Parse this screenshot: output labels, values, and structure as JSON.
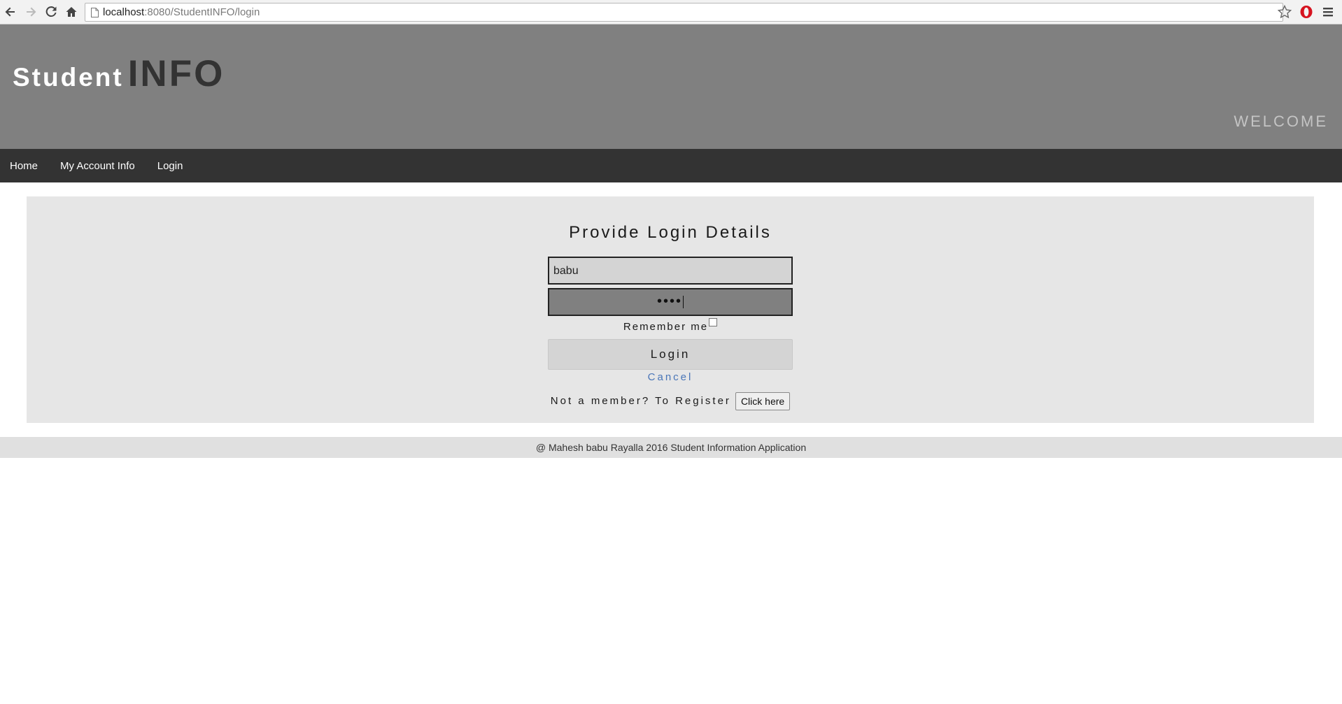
{
  "browser": {
    "url_host": "localhost",
    "url_rest": ":8080/StudentINFO/login",
    "back_icon": "back-arrow-icon",
    "forward_icon": "forward-arrow-icon",
    "reload_icon": "reload-icon",
    "home_icon": "home-icon",
    "bookmark_icon": "star-icon",
    "extension_icon": "opera-icon",
    "menu_icon": "hamburger-menu-icon"
  },
  "header": {
    "brand_student": "Student",
    "brand_info": "INFO",
    "welcome": "WELCOME",
    "background_color": "#808080"
  },
  "nav": {
    "items": [
      {
        "label": "Home"
      },
      {
        "label": "My Account Info"
      },
      {
        "label": "Login"
      }
    ],
    "background_color": "#333333"
  },
  "login": {
    "title": "Provide Login Details",
    "username_value": "babu",
    "password_mask": "••••",
    "remember_label": "Remember me",
    "remember_checked": false,
    "submit_label": "Login",
    "cancel_label": "Cancel",
    "register_prompt": "Not a member? To Register",
    "register_button": "Click here"
  },
  "footer": {
    "text": "@ Mahesh babu Rayalla 2016 Student Information Application"
  }
}
